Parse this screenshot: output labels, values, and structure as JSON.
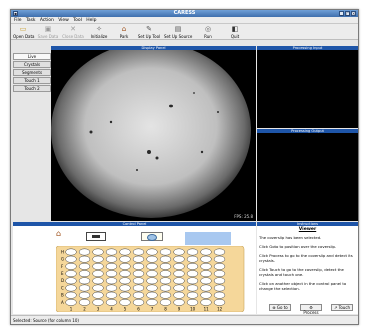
{
  "window": {
    "title": "CARESS"
  },
  "menu": [
    "File",
    "Task",
    "Action",
    "View",
    "Tool",
    "Help"
  ],
  "toolbar": [
    {
      "label": "Open Data",
      "icon": "folder-icon",
      "enabled": true
    },
    {
      "label": "Save Data",
      "icon": "save-icon",
      "enabled": false
    },
    {
      "label": "Close Data",
      "icon": "close-icon",
      "enabled": false
    },
    {
      "label": "Initialize",
      "icon": "initialize-icon",
      "enabled": true
    },
    {
      "label": "Park",
      "icon": "home-icon",
      "enabled": true
    },
    {
      "label": "Set Up Tool",
      "icon": "wrench-icon",
      "enabled": true
    },
    {
      "label": "Set Up Source",
      "icon": "source-icon",
      "enabled": true
    },
    {
      "label": "Run",
      "icon": "run-icon",
      "enabled": true
    },
    {
      "label": "Quit",
      "icon": "quit-icon",
      "enabled": true
    }
  ],
  "side_tabs": [
    "Live",
    "Crystals",
    "Segments",
    "Touch 1",
    "Touch 2"
  ],
  "display_panel": {
    "title": "Display Panel",
    "fps": "FPS: 25.8"
  },
  "processing_input": {
    "title": "Processing Input"
  },
  "processing_output": {
    "title": "Processing Output"
  },
  "control_panel": {
    "title": "Control Panel"
  },
  "plate": {
    "row_labels": [
      "H",
      "G",
      "F",
      "E",
      "D",
      "C",
      "B",
      "A"
    ],
    "col_labels": [
      "1",
      "2",
      "3",
      "4",
      "5",
      "6",
      "7",
      "8",
      "9",
      "10",
      "11",
      "12"
    ]
  },
  "instructions": {
    "title": "Instructions",
    "heading": "Viewer",
    "lines": [
      "The coverslip has been selected.",
      "Click Goto to position over the coverslip.",
      "Click Process to go to the coverslip and detect its crystals.",
      "Click Touch to go to the coverslip, detect the crystals and touch one.",
      "Click on another object in the control panel to change the selection."
    ],
    "buttons": [
      "Go to",
      "Process",
      "Touch"
    ]
  },
  "status": {
    "text": "Selected: Source (for column 10)"
  }
}
